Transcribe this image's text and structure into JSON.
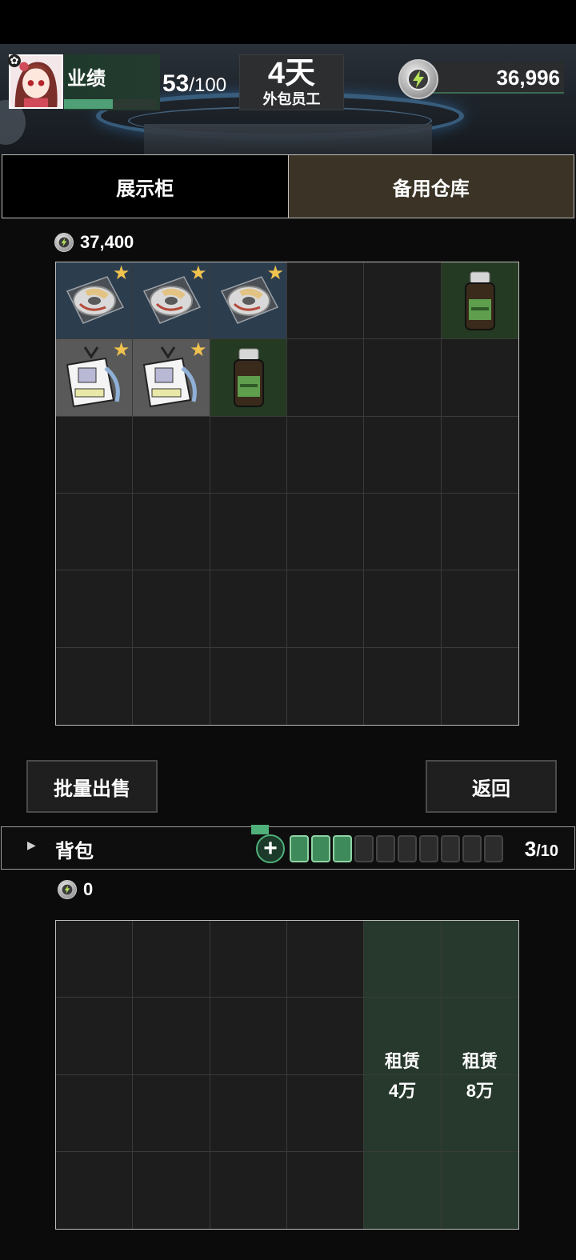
{
  "header": {
    "performance_label": "业绩",
    "performance_current": "53",
    "performance_max": "/100",
    "performance_fraction": 0.53,
    "days": "4天",
    "role": "外包员工",
    "coins": "36,996"
  },
  "tabs": [
    {
      "label": "展示柜",
      "active": false
    },
    {
      "label": "备用仓库",
      "active": true
    }
  ],
  "storage": {
    "total_value": "37,400",
    "rows": 6,
    "cols": 6,
    "items": [
      {
        "slot": 0,
        "kind": "disc",
        "starred": true
      },
      {
        "slot": 1,
        "kind": "disc",
        "starred": true
      },
      {
        "slot": 2,
        "kind": "disc",
        "starred": true
      },
      {
        "slot": 5,
        "kind": "bottle",
        "starred": false
      },
      {
        "slot": 6,
        "kind": "badge",
        "starred": true
      },
      {
        "slot": 7,
        "kind": "badge",
        "starred": true
      },
      {
        "slot": 8,
        "kind": "bottle",
        "starred": false
      }
    ]
  },
  "buttons": {
    "bulk_sell": "批量出售",
    "back": "返回"
  },
  "backpack": {
    "label": "背包",
    "filled_slots": 3,
    "total_slots": 10,
    "count_current": "3",
    "count_max": "/10",
    "total_value": "0",
    "rent_label_a": "租赁",
    "rent_price_a": "4万",
    "rent_label_b": "租赁",
    "rent_price_b": "8万"
  },
  "colors": {
    "accent_green": "#4fa076",
    "star": "#f0c24e",
    "storage_tab_bg": "#3b3426"
  }
}
